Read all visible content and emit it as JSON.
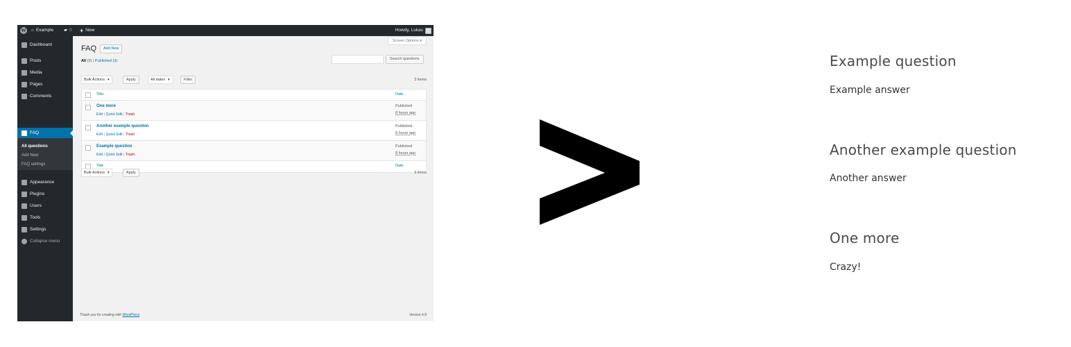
{
  "admin_bar": {
    "site_name": "Example",
    "comments_count": "0",
    "new_label": "New",
    "howdy": "Howdy, Lukas"
  },
  "sidebar": {
    "items": [
      {
        "label": "Dashboard",
        "icon": "dashboard-icon"
      },
      {
        "label": "Posts",
        "icon": "pin-icon"
      },
      {
        "label": "Media",
        "icon": "media-icon"
      },
      {
        "label": "Pages",
        "icon": "pages-icon"
      },
      {
        "label": "Comments",
        "icon": "comment-icon"
      },
      {
        "label": "FAQ",
        "icon": "megaphone-icon"
      },
      {
        "label": "Appearance",
        "icon": "brush-icon"
      },
      {
        "label": "Plugins",
        "icon": "plug-icon"
      },
      {
        "label": "Users",
        "icon": "user-icon"
      },
      {
        "label": "Tools",
        "icon": "wrench-icon"
      },
      {
        "label": "Settings",
        "icon": "settings-icon"
      },
      {
        "label": "Collapse menu",
        "icon": "collapse-icon"
      }
    ],
    "submenu": [
      "All questions",
      "Add New",
      "FAQ settings"
    ]
  },
  "content": {
    "screen_options": "Screen Options",
    "page_title": "FAQ",
    "add_new": "Add New",
    "filter_all": "All",
    "filter_all_count": "(3)",
    "filter_published": "Published (3)",
    "search_button": "Search questions",
    "bulk_actions": "Bulk Actions",
    "apply": "Apply",
    "all_dates": "All dates",
    "filter": "Filter",
    "items_count": "3 items",
    "col_title": "Title",
    "col_date": "Date",
    "rows": [
      {
        "title": "One more",
        "edit": "Edit",
        "quick_edit": "Quick Edit",
        "trash": "Trash",
        "status": "Published",
        "ago": "8 hours ago"
      },
      {
        "title": "Another example question",
        "edit": "Edit",
        "quick_edit": "Quick Edit",
        "trash": "Trash",
        "status": "Published",
        "ago": "8 hours ago"
      },
      {
        "title": "Example question",
        "edit": "Edit",
        "quick_edit": "Quick Edit",
        "trash": "Trash",
        "status": "Published",
        "ago": "8 hours ago"
      }
    ],
    "footer_thanks": "Thank you for creating with",
    "footer_wordpress": "WordPress",
    "footer_version": "Version 4.8"
  },
  "output": {
    "faqs": [
      {
        "question": "Example question",
        "answer": "Example answer"
      },
      {
        "question": "Another example question",
        "answer": "Another answer"
      },
      {
        "question": "One more",
        "answer": "Crazy!"
      }
    ]
  },
  "colors": {
    "admin_dark": "#23282d",
    "accent_blue": "#0073aa",
    "trash_red": "#aa0000"
  }
}
